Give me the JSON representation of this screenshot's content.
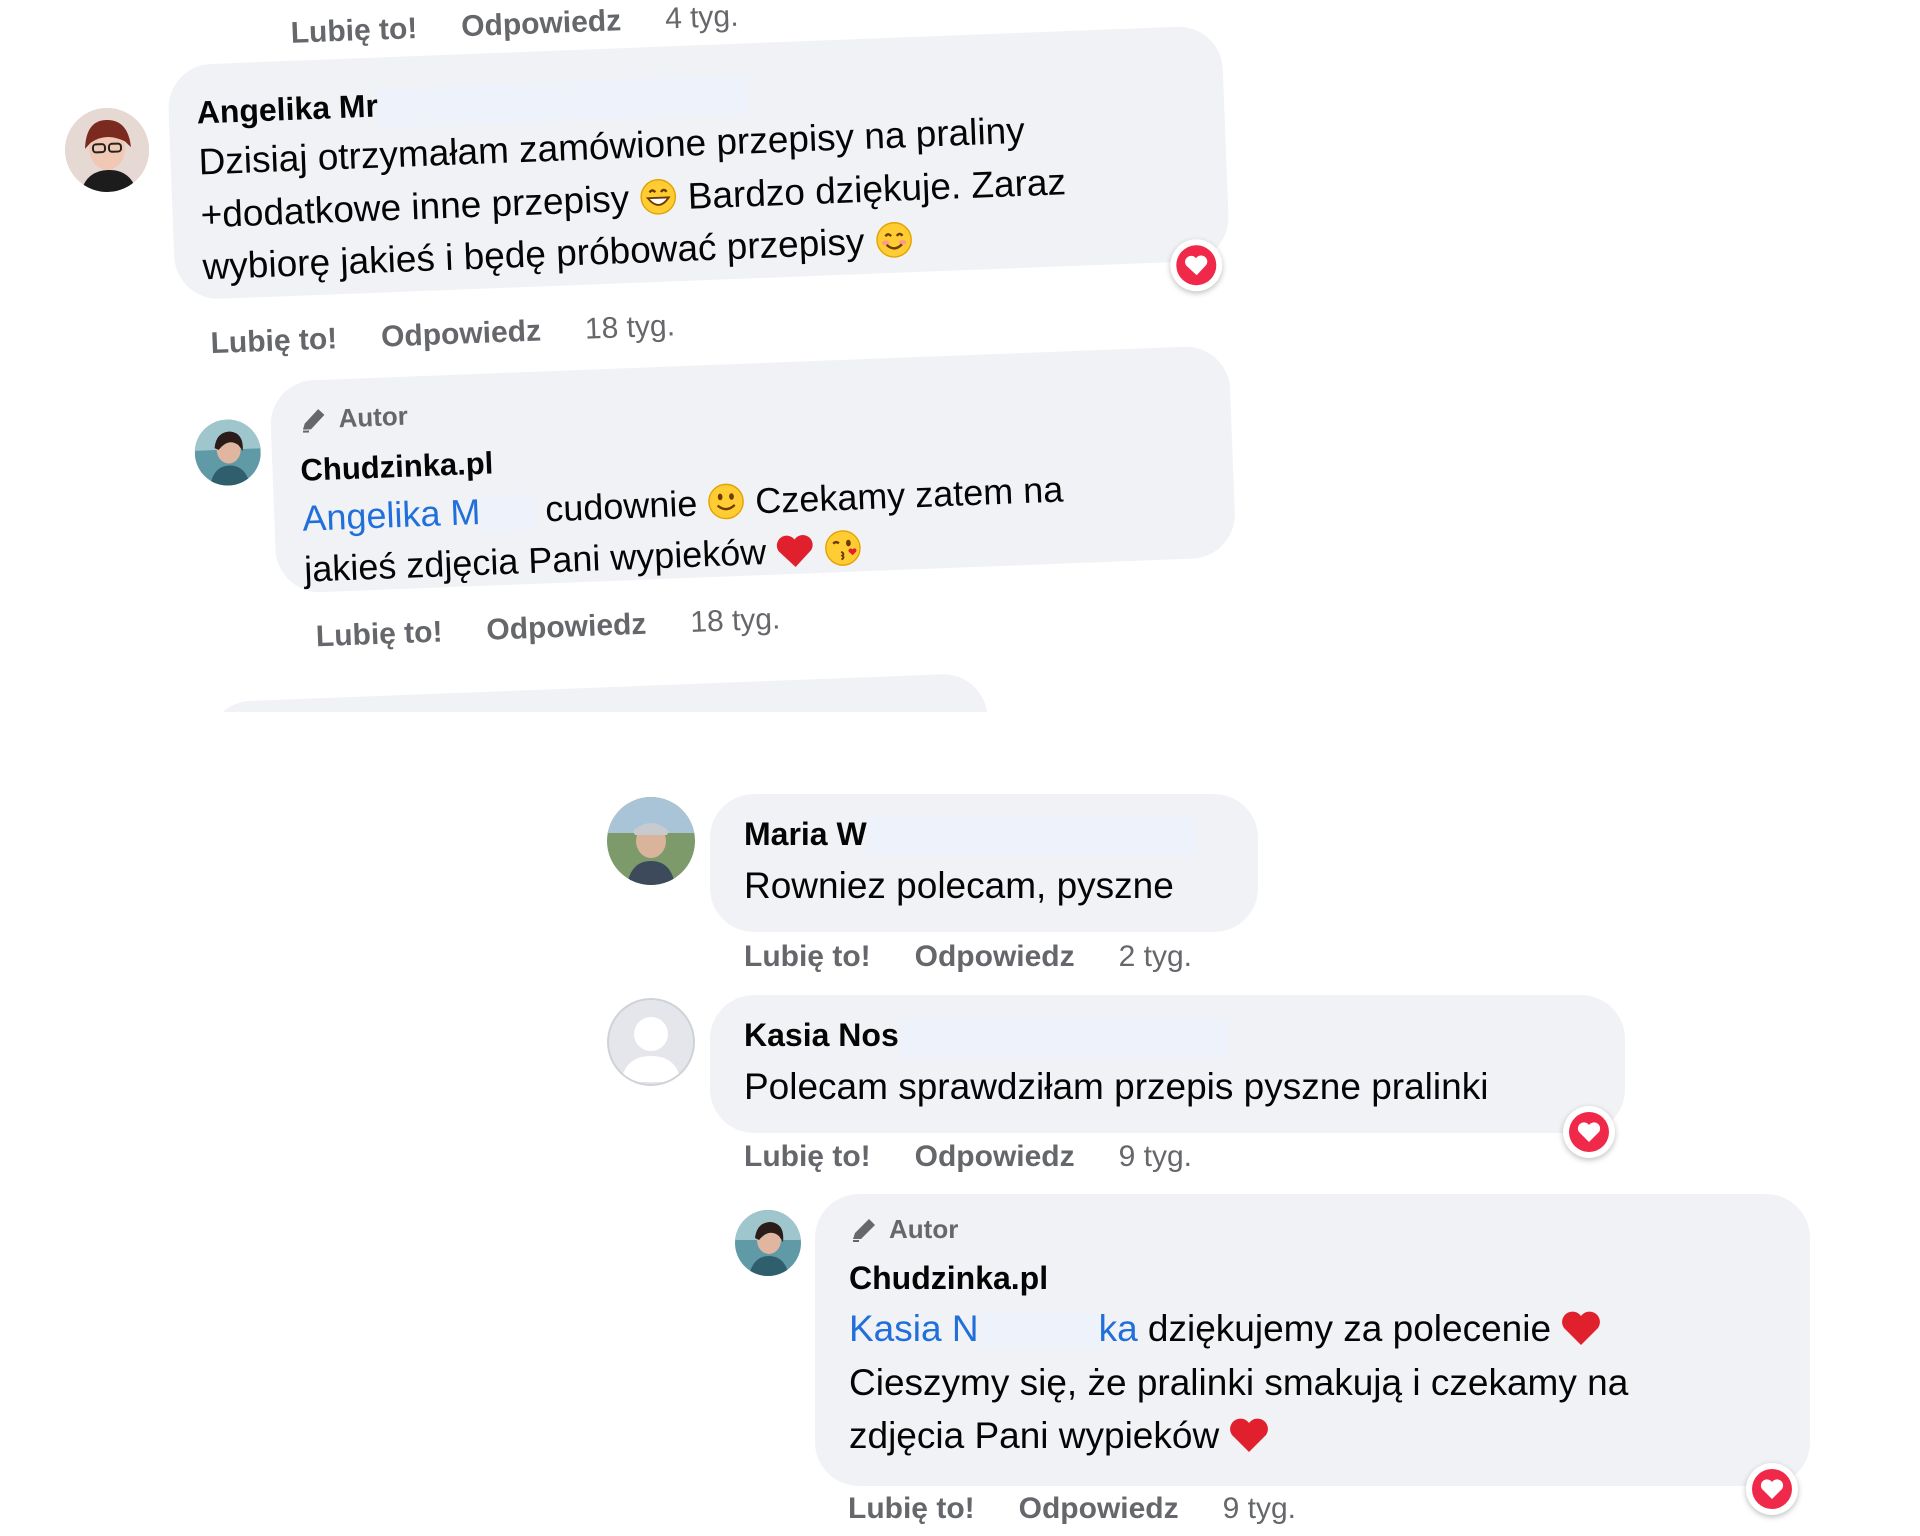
{
  "comments_a": {
    "prev": {
      "like": "Lubię to!",
      "reply": "Odpowiedz",
      "time": "4 tyg."
    },
    "c1": {
      "author": "Angelika Mr",
      "line1": "Dzisiaj otrzymałam zamówione przepisy na praliny",
      "line2a": "+dodatkowe inne przepisy",
      "line2b": "Bardzo dziękuje. Zaraz",
      "line3": "wybiorę jakieś i będę próbować przepisy",
      "emoji_1": "grinning-face-icon",
      "emoji_2": "smiling-face-icon",
      "reaction": "love-icon",
      "like": "Lubię to!",
      "reply": "Odpowiedz",
      "time": "18 tyg."
    },
    "r1": {
      "badge": "Autor",
      "author": "Chudzinka.pl",
      "mention": "Angelika M",
      "line1": "cudownie",
      "line1b": "Czekamy zatem na",
      "line2": "jakieś zdjęcia Pani wypieków",
      "like": "Lubię to!",
      "reply": "Odpowiedz",
      "time": "18 tyg."
    }
  },
  "comments_b": {
    "c1": {
      "author": "Maria W",
      "text": "Rowniez polecam, pyszne",
      "like": "Lubię to!",
      "reply": "Odpowiedz",
      "time": "2 tyg."
    },
    "c2": {
      "author": "Kasia Nos",
      "text": "Polecam sprawdziłam przepis pyszne pralinki",
      "reaction": "love-icon",
      "like": "Lubię to!",
      "reply": "Odpowiedz",
      "time": "9 tyg."
    },
    "r1": {
      "badge": "Autor",
      "author": "Chudzinka.pl",
      "mention": "Kasia N",
      "mention_end": "ka",
      "line1": "dziękujemy za polecenie",
      "line2": "Cieszymy się, że pralinki smakują i czekamy na",
      "line3": "zdjęcia Pani wypieków",
      "reaction": "love-icon",
      "like": "Lubię to!",
      "reply": "Odpowiedz",
      "time": "9 tyg."
    }
  },
  "colors": {
    "bubble": "#f0f2f5",
    "link": "#216fdb",
    "meta": "#65676b",
    "heart": "#f0284a"
  }
}
